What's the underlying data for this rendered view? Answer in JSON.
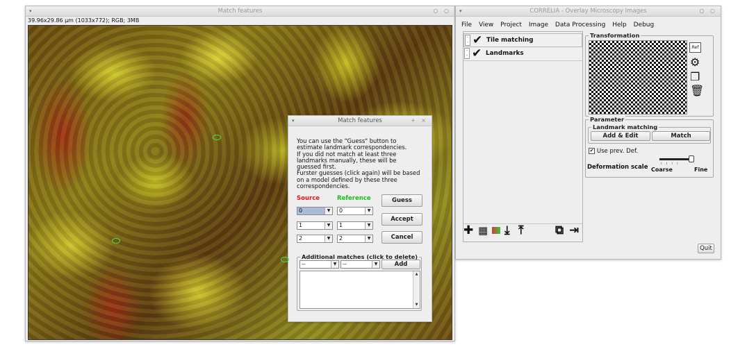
{
  "image_window": {
    "title": "Match features",
    "info": "39.96x29.86 µm (1033x772); RGB; 3MB",
    "controls": "○ ○"
  },
  "dialog": {
    "title": "Match features",
    "controls": "+ ×",
    "instructions": "You can use the \"Guess\" button to\nestimate landmark correspondencies.\nIf you did not match at least three\nlandmarks manually, these will be\nguessed first.\nFurster guesses (click again) will be based\non a model defined by these three\ncorrespondencies.",
    "source_label": "Source",
    "reference_label": "Reference",
    "rows": [
      {
        "source": "0",
        "reference": "0"
      },
      {
        "source": "1",
        "reference": "1"
      },
      {
        "source": "2",
        "reference": "2"
      }
    ],
    "guess_label": "Guess",
    "accept_label": "Accept",
    "cancel_label": "Cancel",
    "additional_title": "Additional matches (click to delete)",
    "add_source": "--",
    "add_reference": "--",
    "add_label": "Add"
  },
  "main_window": {
    "title": "CORRELIA - Overlay Microscopy Images",
    "controls": "○ ○",
    "menu": [
      "File",
      "View",
      "Project",
      "Image",
      "Data Processing",
      "Help",
      "Debug"
    ],
    "tree": [
      {
        "label": "Tile matching"
      },
      {
        "label": "Landmarks"
      }
    ],
    "transformation_title": "Transformation",
    "ref_label": "Ref",
    "parameter_title": "Parameter",
    "landmark_matching_title": "Landmark matching",
    "add_edit_label": "Add & Edit",
    "match_label": "Match",
    "use_prev_label": "Use prev. Def.",
    "use_prev_checked": true,
    "deformation_label": "Deformation scale",
    "coarse_label": "Coarse",
    "fine_label": "Fine",
    "quit_label": "Quit"
  }
}
